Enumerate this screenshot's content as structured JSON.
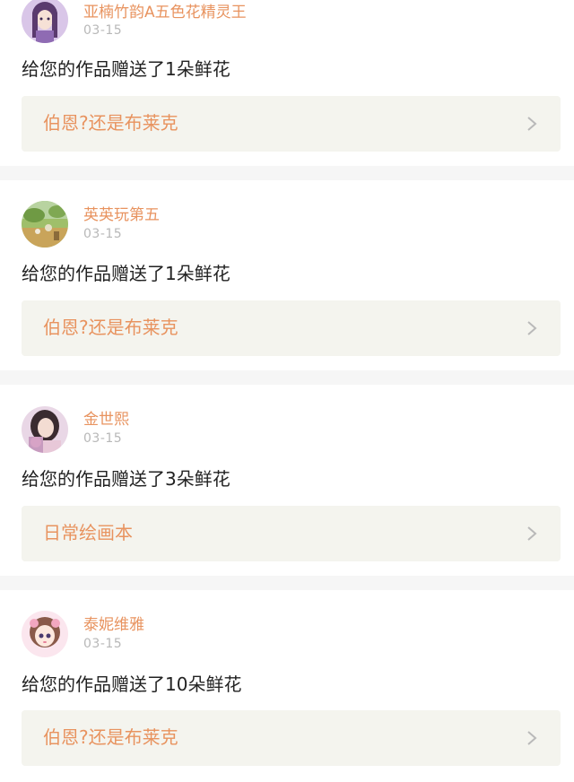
{
  "notifications": [
    {
      "username": "亚楠竹韵A五色花精灵王",
      "date": "03-15",
      "message": "给您的作品赠送了1朵鲜花",
      "work_title": "伯恩?还是布莱克",
      "avatar_icon": "avatar-anime-girl-purple"
    },
    {
      "username": "英英玩第五",
      "date": "03-15",
      "message": "给您的作品赠送了1朵鲜花",
      "work_title": "伯恩?还是布莱克",
      "avatar_icon": "avatar-landscape-painting"
    },
    {
      "username": "金世熙",
      "date": "03-15",
      "message": "给您的作品赠送了3朵鲜花",
      "work_title": "日常绘画本",
      "avatar_icon": "avatar-girl-photo"
    },
    {
      "username": "泰妮维雅",
      "date": "03-15",
      "message": "给您的作品赠送了10朵鲜花",
      "work_title": "伯恩?还是布莱克",
      "avatar_icon": "avatar-anime-girl-pink"
    }
  ],
  "colors": {
    "accent": "#e8935f",
    "date": "#b8b8b8",
    "text": "#222222",
    "link_bg": "#f4f4ee",
    "page_bg": "#f6f6f6"
  }
}
